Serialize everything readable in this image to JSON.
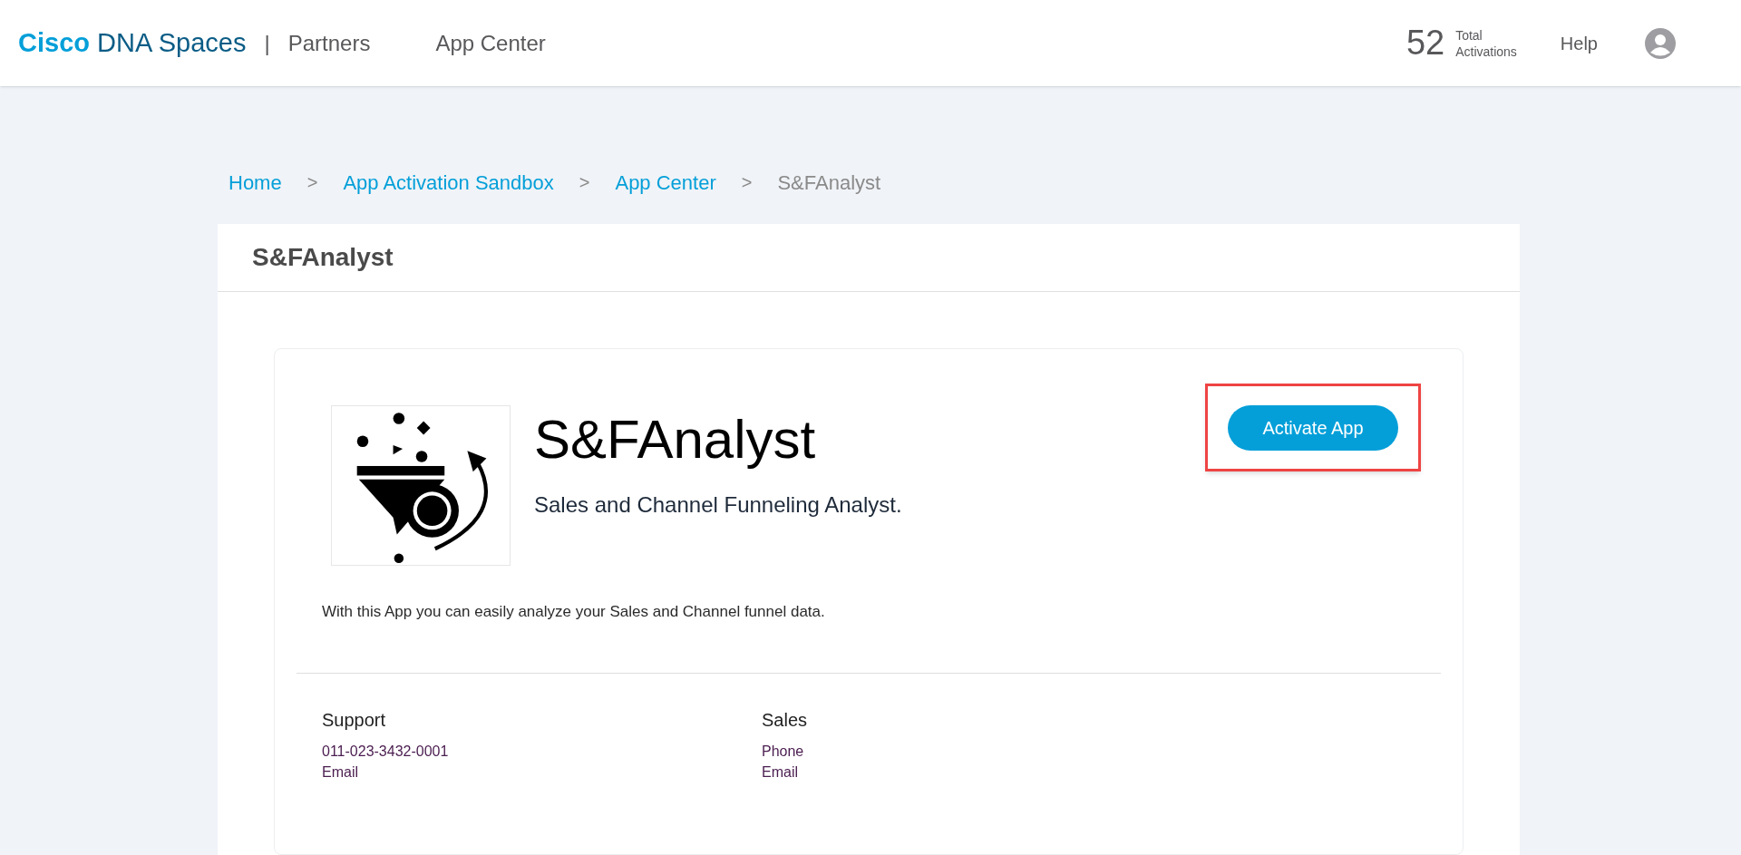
{
  "header": {
    "brand_bold": "Cisco",
    "brand_rest": "DNA Spaces",
    "separator": "|",
    "partners": "Partners",
    "nav": "App Center",
    "activations_count": "52",
    "activations_label_1": "Total",
    "activations_label_2": "Activations",
    "help": "Help"
  },
  "breadcrumb": [
    {
      "label": "Home",
      "current": false
    },
    {
      "label": "App Activation Sandbox",
      "current": false
    },
    {
      "label": "App Center",
      "current": false
    },
    {
      "label": "S&FAnalyst",
      "current": true
    }
  ],
  "breadcrumb_separator": ">",
  "panel": {
    "title": "S&FAnalyst"
  },
  "app": {
    "name": "S&FAnalyst",
    "tagline": "Sales and Channel Funneling Analyst.",
    "description": "With this App you can easily analyze your Sales and Channel funnel data.",
    "activate_button": {
      "label": "Activate App",
      "highlighted": true
    }
  },
  "contacts": [
    {
      "title": "Support",
      "lines": [
        "011-023-3432-0001",
        "Email"
      ]
    },
    {
      "title": "Sales",
      "lines": [
        "Phone",
        "Email"
      ]
    }
  ]
}
